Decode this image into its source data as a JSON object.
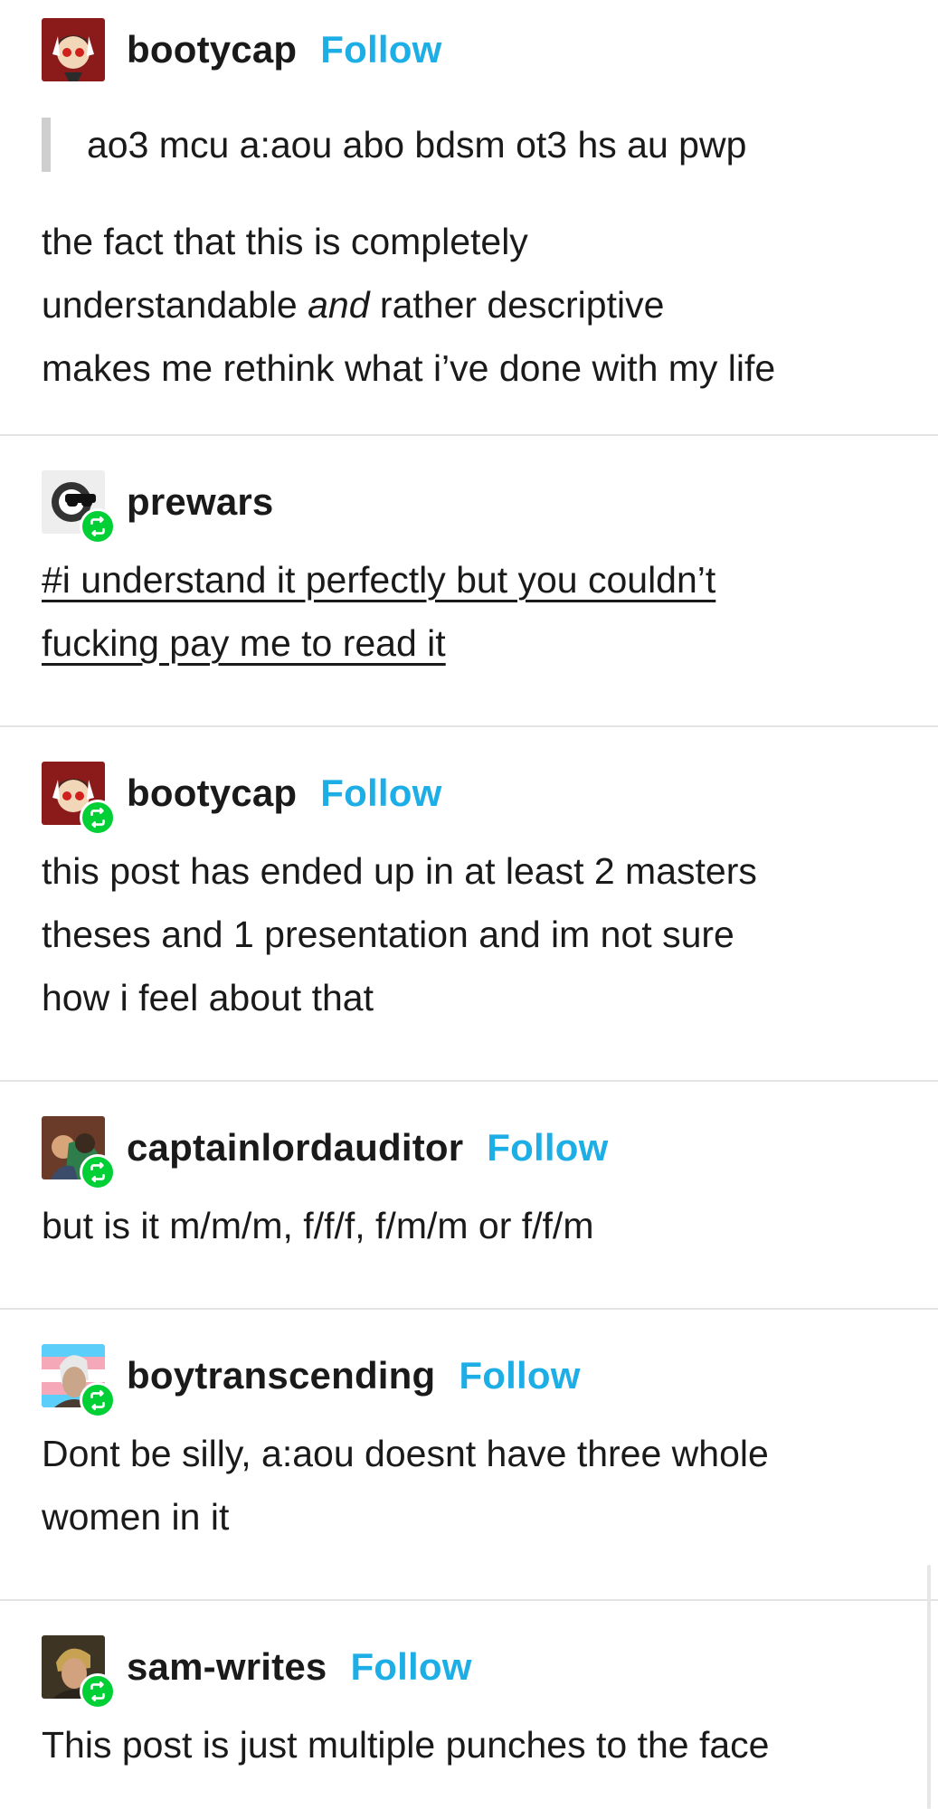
{
  "posts": [
    {
      "username": "bootycap",
      "follow_label": "Follow",
      "quote": "ao3 mcu a:aou abo bdsm ot3 hs au pwp",
      "lines": [
        "the fact that this is completely",
        "understandable",
        "and",
        "rather descriptive",
        "makes me rethink what i’ve done with my life"
      ]
    },
    {
      "username": "prewars",
      "tag_lines": [
        "#i understand it perfectly but you couldn’t",
        "fucking pay me to read it"
      ]
    },
    {
      "username": "bootycap",
      "follow_label": "Follow",
      "lines": [
        "this post has ended up in at least 2 masters",
        "theses and 1 presentation and im not sure",
        "how i feel about that"
      ]
    },
    {
      "username": "captainlordauditor",
      "follow_label": "Follow",
      "lines": [
        "but is it m/m/m, f/f/f, f/m/m or f/f/m"
      ]
    },
    {
      "username": "boytranscending",
      "follow_label": "Follow",
      "lines": [
        "Dont be silly, a:aou doesnt have three whole",
        "women in it"
      ]
    },
    {
      "username": "sam-writes",
      "follow_label": "Follow",
      "lines": [
        "This post is just multiple punches to the face"
      ]
    }
  ],
  "colors": {
    "follow": "#1eaee6",
    "reblog_badge": "#00cf35",
    "text": "#1a1a1a",
    "divider": "#e3e3e3",
    "quote_bar": "#cfcfcf"
  },
  "icons": {
    "reblog": "reblog-icon",
    "avatar": "avatar-image"
  }
}
